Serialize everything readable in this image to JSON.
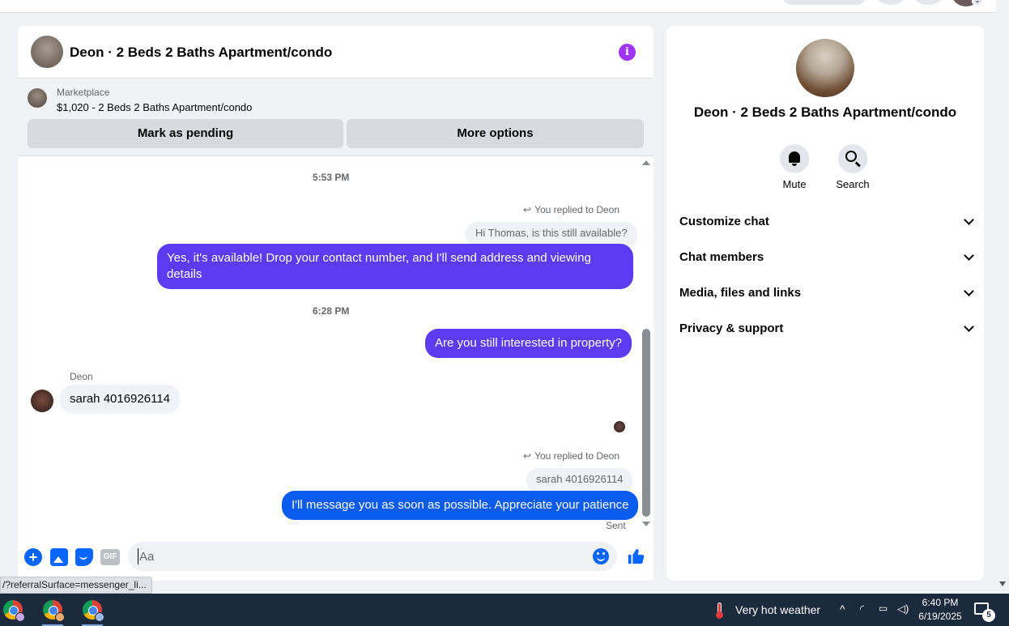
{
  "header": {
    "title": "Deon · 2 Beds 2 Baths Apartment/condo"
  },
  "marketplace": {
    "label": "Marketplace",
    "listing": "$1,020 - 2 Beds 2 Baths Apartment/condo",
    "mark_pending": "Mark as pending",
    "more_options": "More options"
  },
  "messages": {
    "ts1": "5:53 PM",
    "replied1": "You replied to Deon",
    "quoted1": "Hi Thomas, is this still available?",
    "out1": "Yes, it's available! Drop your contact number, and I'll send address and viewing details",
    "ts2": "6:28 PM",
    "out2": "Are you still interested in property?",
    "sender": "Deon",
    "in1": "sarah  4016926114",
    "replied2": "You replied to Deon",
    "quoted2": "sarah  4016926114",
    "out3": "I'll message you as soon as possible. Appreciate your patience",
    "status": "Sent"
  },
  "composer": {
    "placeholder": "Aa",
    "gif_label": "GIF"
  },
  "details": {
    "name": "Deon · 2 Beds 2 Baths Apartment/condo",
    "mute": "Mute",
    "search": "Search",
    "sections": [
      "Customize chat",
      "Chat members",
      "Media, files and links",
      "Privacy & support"
    ]
  },
  "status_bar": {
    "url": "/?referralSurface=messenger_li..."
  },
  "taskbar": {
    "weather": "Very hot weather",
    "time": "6:40 PM",
    "date": "6/19/2025",
    "notifications": "5"
  },
  "colors": {
    "outgoing_purple": "#5b3cf3",
    "outgoing_blue": "#0a5cf0",
    "accent": "#0866ff",
    "info": "#a033ff"
  }
}
